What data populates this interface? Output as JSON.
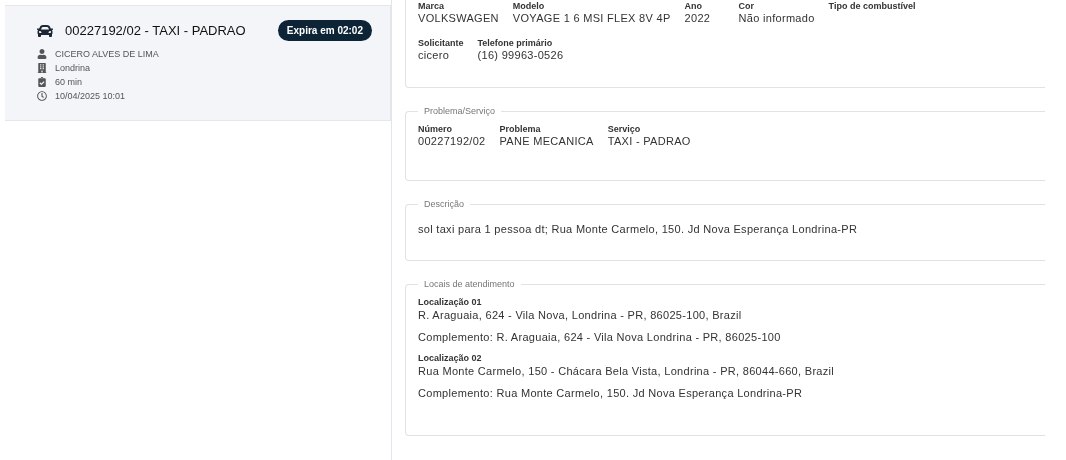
{
  "orders": [
    {
      "title": "00227192/02 - TAXI - PADRAO",
      "badge": "Expira em 02:02",
      "selected": true,
      "details": [
        {
          "kind": "person",
          "text": "CICERO ALVES DE LIMA"
        },
        {
          "kind": "building",
          "text": "Londrina"
        },
        {
          "kind": "clipboard",
          "text": "60 min"
        },
        {
          "kind": "clock",
          "text": "10/04/2025 10:01"
        }
      ]
    }
  ],
  "sections": [
    {
      "kind": "fields",
      "rows": [
        [
          {
            "label": "Marca",
            "value": "VOLKSWAGEN"
          },
          {
            "label": "Modelo",
            "value": "VOYAGE 1 6 MSI FLEX 8V 4P"
          },
          {
            "label": "Ano",
            "value": "2022"
          },
          {
            "label": "Cor",
            "value": "Não informado"
          },
          {
            "label": "Tipo de combustível"
          }
        ],
        [
          {
            "label": "Solicitante",
            "value": "cicero"
          },
          {
            "label": "Telefone primário",
            "value": "(16) 99963-0526"
          }
        ]
      ]
    },
    {
      "kind": "fields",
      "legend": "Problema/Serviço",
      "rows": [
        [
          {
            "label": "Número",
            "value": "00227192/02"
          },
          {
            "label": "Problema",
            "value": "PANE MECANICA"
          },
          {
            "label": "Serviço",
            "value": "TAXI - PADRAO"
          }
        ]
      ]
    },
    {
      "kind": "text",
      "legend": "Descrição",
      "text": "sol taxi para 1 pessoa dt; Rua Monte Carmelo, 150. Jd Nova Esperança Londrina-PR"
    },
    {
      "kind": "locations",
      "legend": "Locais de atendimento",
      "locations": [
        {
          "label": "Localização 01",
          "address": "R. Araguaia, 624 - Vila Nova, Londrina - PR, 86025-100, Brazil",
          "complement": "Complemento: R. Araguaia, 624 - Vila Nova Londrina - PR, 86025-100"
        },
        {
          "label": "Localização 02",
          "address": "Rua Monte Carmelo, 150 - Chácara Bela Vista, Londrina - PR, 86044-660, Brazil",
          "complement": "Complemento: Rua Monte Carmelo, 150. Jd Nova Esperança Londrina-PR"
        }
      ]
    }
  ]
}
